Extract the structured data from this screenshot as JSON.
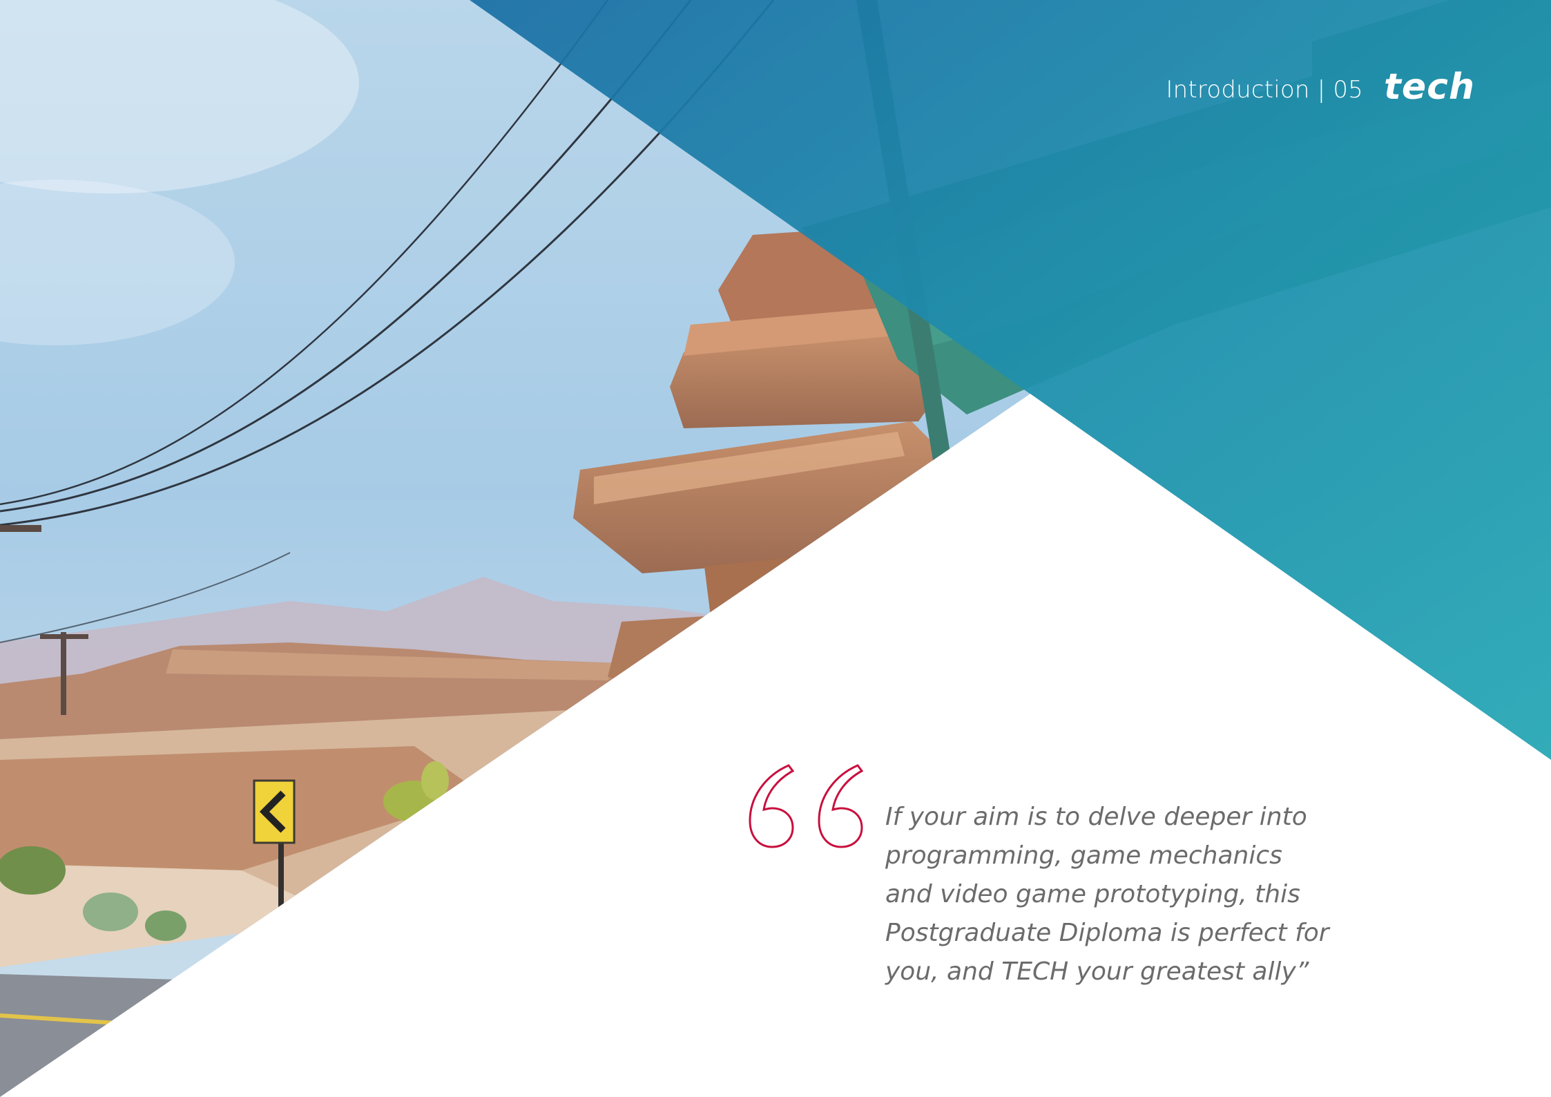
{
  "header": {
    "section_label": "Introduction | 05",
    "logo_text": "tec",
    "logo_last_letter": "h"
  },
  "quote": {
    "lines": [
      "If your aim is to delve deeper into",
      "programming, game mechanics",
      "and video game prototyping, this",
      "Postgraduate Diploma is perfect for",
      "you, and TECH your greatest ally”"
    ]
  },
  "colors": {
    "teal_dark": "#1d7fa6",
    "teal_light": "#26a8b4",
    "quote_mark": "#c8103e",
    "quote_text": "#6b6b6b"
  },
  "icons": {
    "quote_mark": "open-quote-icon",
    "photo": "desert-game-scene-illustration"
  }
}
